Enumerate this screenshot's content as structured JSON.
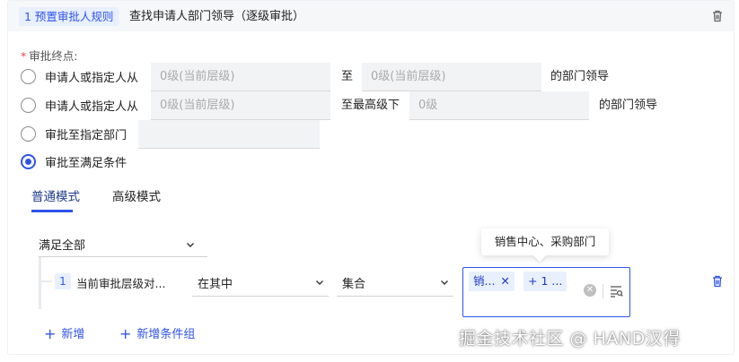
{
  "header": {
    "rule_tag": "1 预置审批人规则",
    "title": "查找申请人部门领导（逐级审批）"
  },
  "endpoint": {
    "label": "审批终点:",
    "required_mark": "*",
    "options": [
      {
        "label": "申请人或指定人从",
        "from_placeholder": "0级(当前层级)",
        "to_text": "至",
        "to_placeholder": "0级(当前层级)",
        "suffix": "的部门领导",
        "checked": false
      },
      {
        "label": "申请人或指定人从",
        "from_placeholder": "0级(当前层级)",
        "to_text": "至最高级下",
        "to_placeholder": "0级",
        "suffix": "的部门领导",
        "checked": false
      },
      {
        "label": "审批至指定部门",
        "checked": false
      },
      {
        "label": "审批至满足条件",
        "checked": true
      }
    ]
  },
  "tabs": [
    {
      "label": "普通模式",
      "active": true
    },
    {
      "label": "高级模式",
      "active": false
    }
  ],
  "condition_group": {
    "match_mode": "满足全部",
    "conditions": [
      {
        "index": "1",
        "field": "当前审批层级对...",
        "operator": "在其中",
        "value_type": "集合",
        "chips": [
          "销...",
          "+ 1 ..."
        ],
        "tooltip": "销售中心、采购部门"
      }
    ],
    "add_label": "新增",
    "add_group_label": "新增条件组"
  },
  "watermark": "掘金技术社区 @ HAND汉得",
  "colors": {
    "accent": "#2f54eb",
    "tag_bg": "#e8f0fe",
    "header_bg": "#f6f7f9",
    "input_bg": "#f2f3f5"
  }
}
